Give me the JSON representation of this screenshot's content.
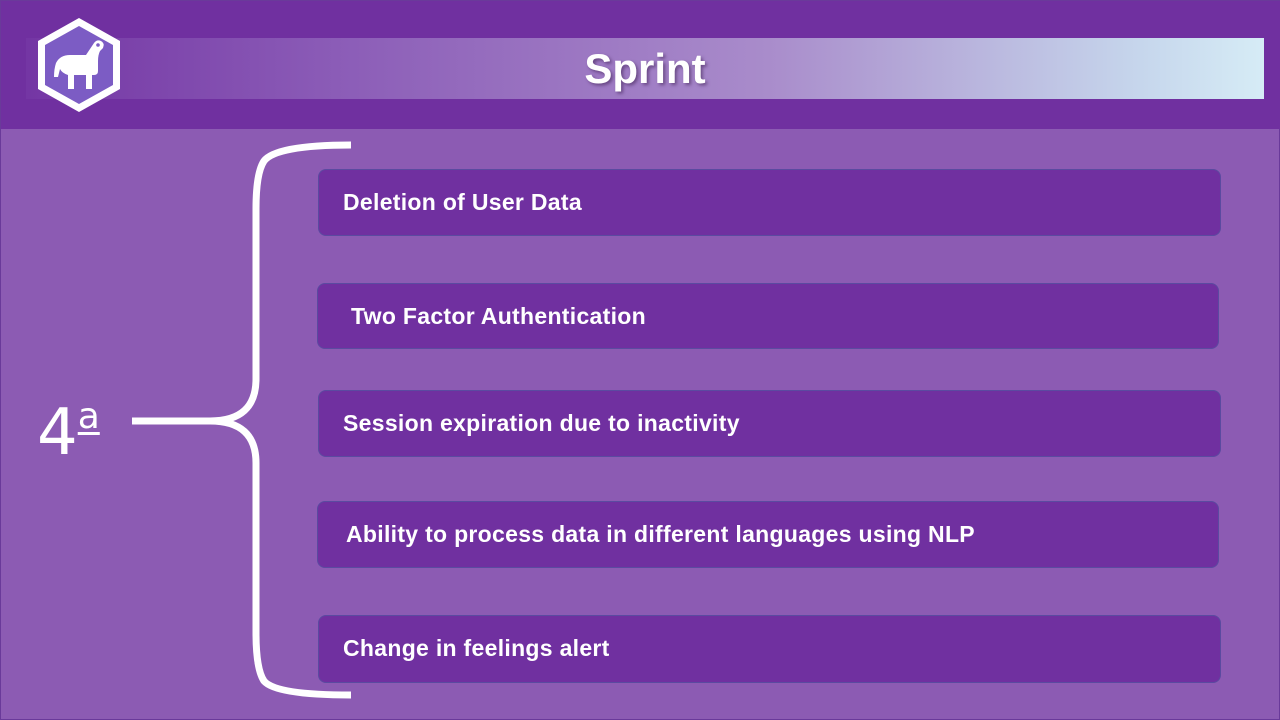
{
  "slide": {
    "title": "Sprint",
    "sprint_number": "4",
    "sprint_ordinal": "a",
    "tasks": [
      "Deletion of User Data",
      "Two Factor Authentication",
      "Session expiration due to inactivity",
      "Ability to process data in different languages using NLP",
      "Change in feelings alert"
    ]
  },
  "colors": {
    "header": "#7030a0",
    "background": "#8c5bb3",
    "task_box": "#7030a0",
    "text": "#ffffff"
  },
  "icons": {
    "logo": "hexagon-animal-logo-icon",
    "brace": "curly-brace-icon"
  }
}
